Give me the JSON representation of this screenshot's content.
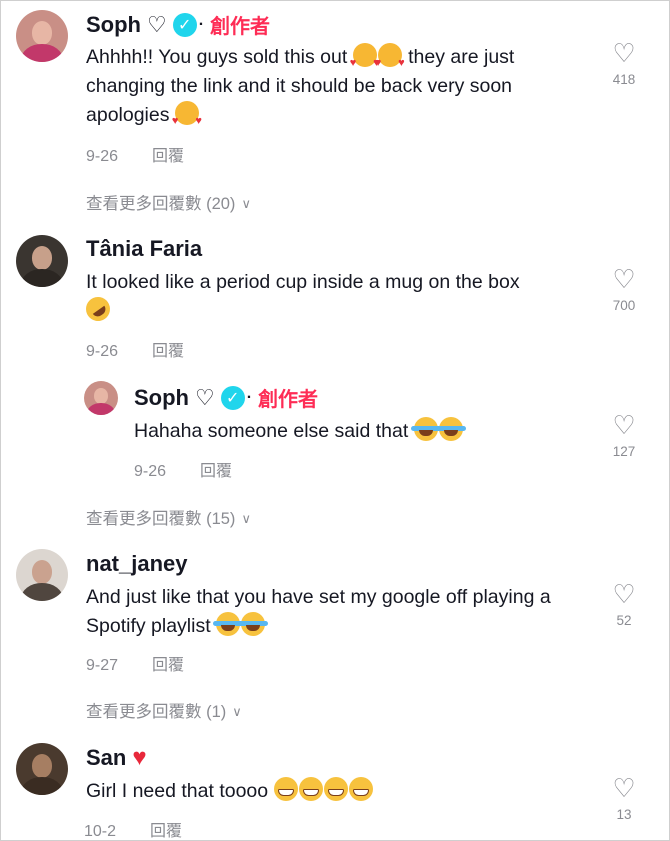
{
  "comments": [
    {
      "name": "Soph",
      "creator_label": "創作者",
      "text": "Ahhhh!! You guys sold this out",
      "text_b": "they are just changing the link and it should be back very soon apologies",
      "date": "9-26",
      "reply_label": "回覆",
      "likes": "418",
      "more_replies": "查看更多回覆數 (20)"
    },
    {
      "name": "Tânia Faria",
      "text": "It looked like a period cup inside a mug on the box",
      "date": "9-26",
      "reply_label": "回覆",
      "likes": "700",
      "more_replies": "查看更多回覆數 (15)"
    },
    {
      "name": "Soph",
      "creator_label": "創作者",
      "text": "Hahaha someone else said that",
      "date": "9-26",
      "reply_label": "回覆",
      "likes": "127"
    },
    {
      "name": "nat_janey",
      "text": "And just like that you have set my google off playing a Spotify playlist",
      "date": "9-27",
      "reply_label": "回覆",
      "likes": "52",
      "more_replies": "查看更多回覆數 (1)"
    },
    {
      "name": "San",
      "text": "Girl I need that toooo",
      "date": "10-2",
      "reply_label": "回覆",
      "likes": "13"
    }
  ],
  "icons": {
    "verified": "verified-check-icon",
    "like": "heart-outline-icon",
    "expand": "chevron-down-icon"
  },
  "colors": {
    "creator": "#fe2c55",
    "verified": "#20d5ec",
    "muted": "#8a8b91"
  }
}
